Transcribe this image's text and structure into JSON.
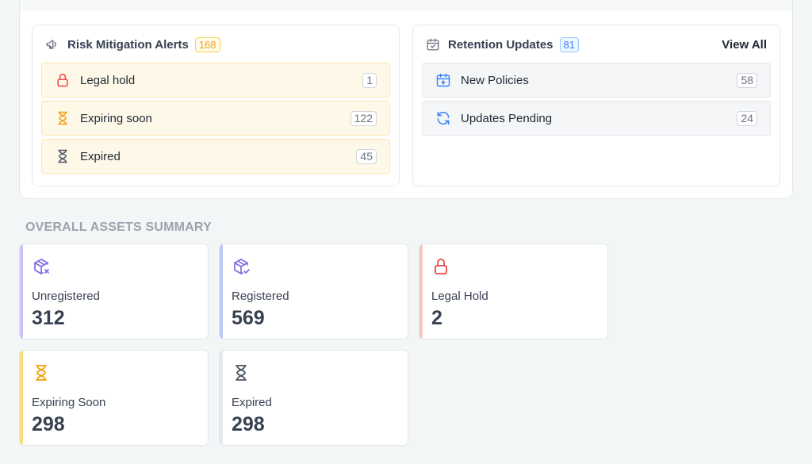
{
  "risk_alerts": {
    "title": "Risk Mitigation Alerts",
    "count": "168",
    "items": [
      {
        "label": "Legal hold",
        "count": "1",
        "icon": "lock-icon"
      },
      {
        "label": "Expiring soon",
        "count": "122",
        "icon": "hourglass-icon"
      },
      {
        "label": "Expired",
        "count": "45",
        "icon": "hourglass-icon"
      }
    ]
  },
  "retention_updates": {
    "title": "Retention Updates",
    "count": "81",
    "view_all": "View All",
    "items": [
      {
        "label": "New Policies",
        "count": "58",
        "icon": "calendar-plus-icon"
      },
      {
        "label": "Updates Pending",
        "count": "24",
        "icon": "refresh-icon"
      }
    ]
  },
  "summary": {
    "title": "OVERALL ASSETS SUMMARY",
    "tiles": [
      {
        "label": "Unregistered",
        "value": "312",
        "icon": "package-x-icon",
        "accent": "#c7c3f4"
      },
      {
        "label": "Registered",
        "value": "569",
        "icon": "package-check-icon",
        "accent": "#b9c8f5"
      },
      {
        "label": "Legal Hold",
        "value": "2",
        "icon": "lock-icon",
        "accent": "#f8c3bd"
      },
      {
        "label": "Expiring Soon",
        "value": "298",
        "icon": "hourglass-icon",
        "accent": "#fcdc7a"
      },
      {
        "label": "Expired",
        "value": "298",
        "icon": "hourglass-icon",
        "accent": "#e5e7eb"
      }
    ]
  },
  "colors": {
    "red": "#ef4444",
    "orange": "#f59e0b",
    "gray": "#4b5563",
    "blue": "#3b82f6",
    "purple": "#7c6ee6"
  }
}
